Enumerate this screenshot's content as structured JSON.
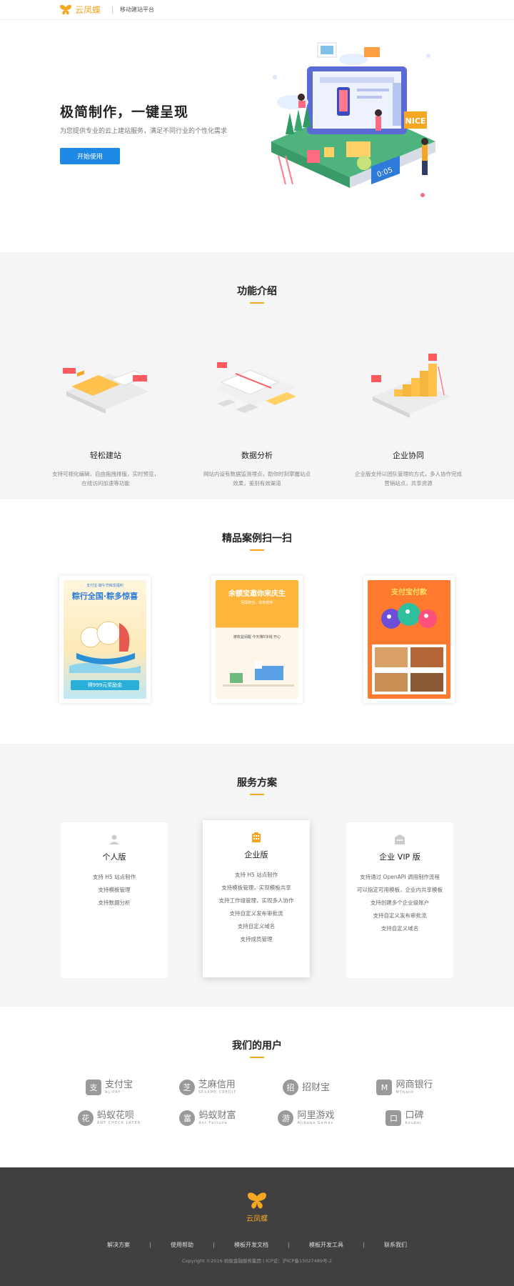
{
  "header": {
    "brand": "云凤蝶",
    "subtitle": "移动建站平台"
  },
  "hero": {
    "title": "极简制作，一键呈现",
    "description": "为您提供专业的云上建站服务，满足不同行业的个性化需求",
    "cta": "开始使用",
    "illustration_badges": [
      "NICE",
      "0:05"
    ]
  },
  "features": {
    "title": "功能介绍",
    "items": [
      {
        "title": "轻松建站",
        "description": "支持可视化编辑，自由拖拽排版，实时预览，在线访问加速等功能"
      },
      {
        "title": "数据分析",
        "description": "网站内设有数据监测埋点，助你时刻掌握站点效果，鉴别有效渠道"
      },
      {
        "title": "企业协同",
        "description": "企业版支持以团队管理的方式，多人协作完成营销站点，共享资源"
      }
    ]
  },
  "cases": {
    "title": "精品案例扫一扫",
    "items": [
      {
        "heading": "粽行全国·粽多惊喜",
        "top_text": "支付宝·端午节粽享福利",
        "bottom_text": "得999元奖励金"
      },
      {
        "heading": "余额宝邀你来庆生",
        "top_text": "回馈粉丝，有你陪伴",
        "bottom_text": "被收益闹醒 今天赚5块钱 开心"
      },
      {
        "heading": "支付宝付款",
        "top_text": "",
        "bottom_text": ""
      }
    ]
  },
  "plans": {
    "title": "服务方案",
    "items": [
      {
        "name": "个人版",
        "features": [
          "支持 H5 站点制作",
          "支持模板管理",
          "支持数据分析"
        ]
      },
      {
        "name": "企业版",
        "features": [
          "支持 H5 站点制作",
          "支持模板管理，实现模板共享",
          "支持工作组管理，实现多人协作",
          "支持自定义发布审批流",
          "支持自定义域名",
          "支持成员管理"
        ]
      },
      {
        "name": "企业 VIP 版",
        "features": [
          "支持通过 OpenAPI 调用制作流程",
          "可以指定可用模板，企业内共享模板",
          "支持创建多个企业级账户",
          "支持自定义发布审批流",
          "支持自定义域名"
        ]
      }
    ]
  },
  "users": {
    "title": "我们的用户",
    "logos": [
      {
        "cn": "支付宝",
        "en": "ALIPAY",
        "mark": "支"
      },
      {
        "cn": "芝麻信用",
        "en": "SESAME CREDIT",
        "mark": "芝"
      },
      {
        "cn": "招财宝",
        "en": "",
        "mark": "招"
      },
      {
        "cn": "网商银行",
        "en": "MYbank",
        "mark": "M"
      },
      {
        "cn": "蚂蚁花呗",
        "en": "ANT CHECK LATER",
        "mark": "花"
      },
      {
        "cn": "蚂蚁财富",
        "en": "Ant Fortune",
        "mark": "富"
      },
      {
        "cn": "阿里游戏",
        "en": "Alibaba Games",
        "mark": "游"
      },
      {
        "cn": "口碑",
        "en": "Koubei",
        "mark": "口"
      }
    ]
  },
  "footer": {
    "brand": "云凤蝶",
    "links": [
      "解决方案",
      "使用帮助",
      "模板开发文档",
      "模板开发工具",
      "联系我们"
    ],
    "copyright": "Copyright ©2016 蚂蚁金融服务集团 | ICP证：沪ICP备15027489号-2"
  },
  "colors": {
    "accent": "#f5a623",
    "primary_button": "#1e88e5",
    "section_gray": "#f5f5f5",
    "footer_bg": "#404040"
  }
}
